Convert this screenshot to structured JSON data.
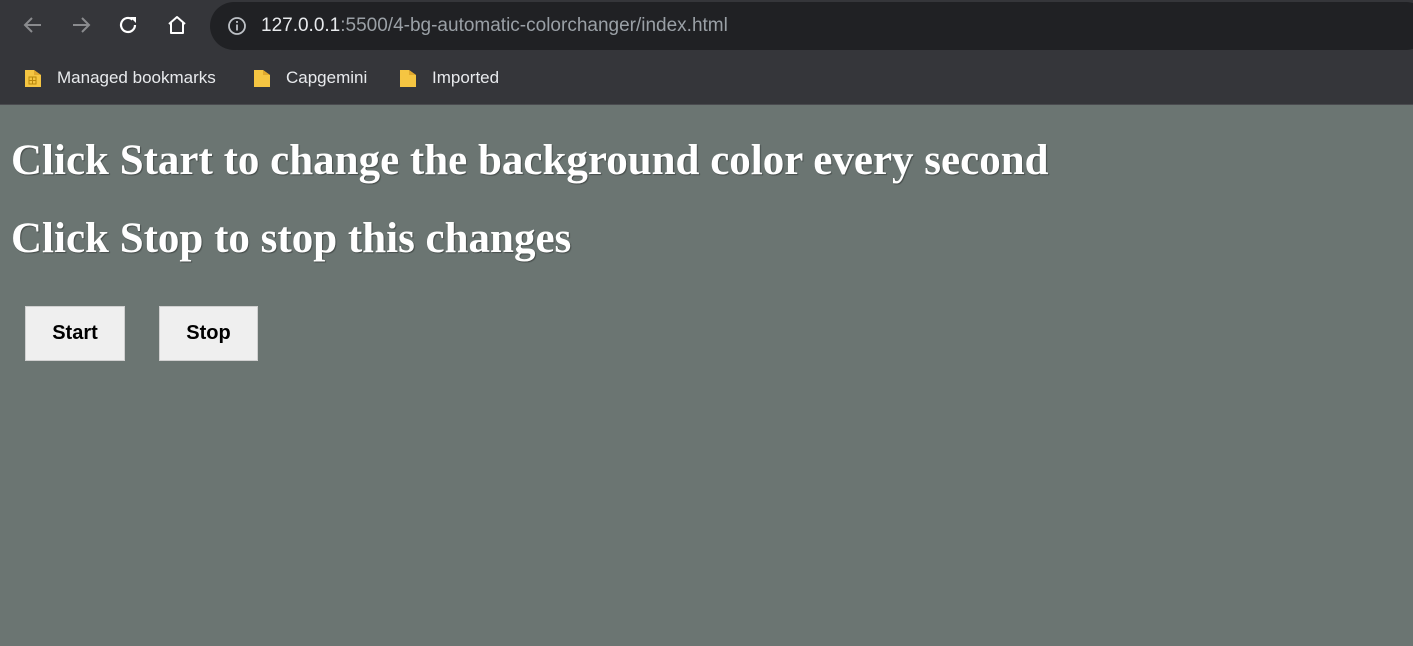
{
  "browser": {
    "url_host": "127.0.0.1",
    "url_path": ":5500/4-bg-automatic-colorchanger/index.html",
    "bookmarks": [
      {
        "label": "Managed bookmarks",
        "icon": "managed-folder-icon"
      },
      {
        "label": "Capgemini",
        "icon": "folder-icon"
      },
      {
        "label": "Imported",
        "icon": "folder-icon"
      }
    ]
  },
  "page": {
    "background_color": "#6b7572",
    "heading_start": "Click Start to change the background color every second",
    "heading_stop": "Click Stop to stop this changes",
    "start_label": "Start",
    "stop_label": "Stop"
  }
}
